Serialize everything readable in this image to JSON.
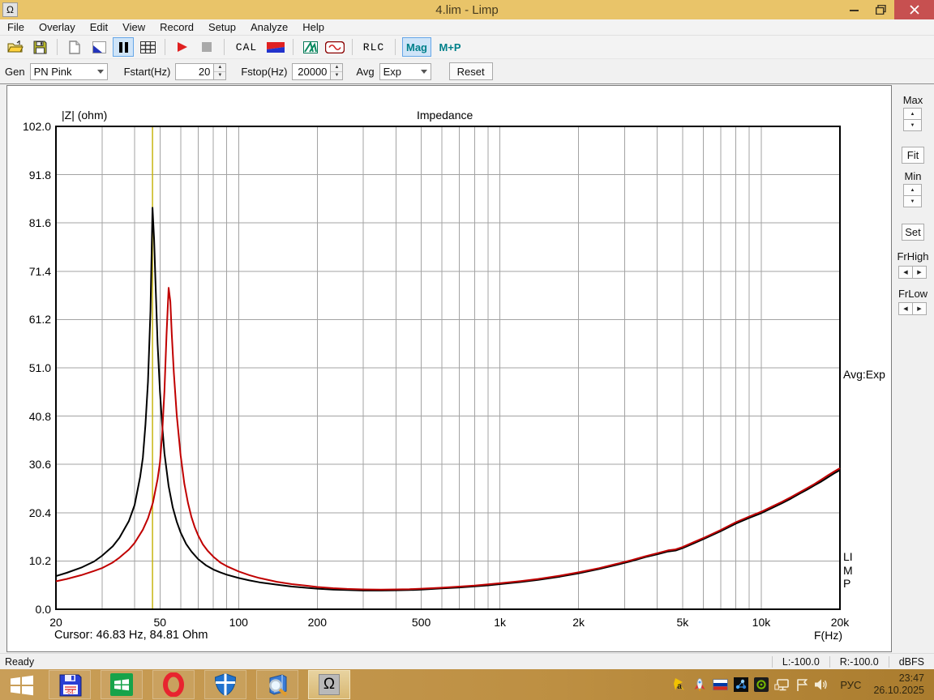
{
  "window": {
    "title": "4.lim - Limp",
    "icon_glyph": "Ω"
  },
  "menu": {
    "items": [
      "File",
      "Overlay",
      "Edit",
      "View",
      "Record",
      "Setup",
      "Analyze",
      "Help"
    ]
  },
  "toolbar": {
    "cal_label": "CAL",
    "rlc_label": "RLC",
    "mag_label": "Mag",
    "mp_label": "M+P",
    "icons": [
      "open-file-icon",
      "save-icon",
      "copy-icon",
      "generator-setup-icon",
      "pause-icon",
      "table-icon",
      "record-play-icon",
      "stop-icon",
      "calibrate-icon",
      "level-meter-icon",
      "spectrum-icon",
      "sine-wave-icon",
      "rlc-meter-icon",
      "magnitude-view-icon",
      "magnitude-phase-view-icon"
    ]
  },
  "controls": {
    "gen_label": "Gen",
    "gen_value": "PN Pink",
    "fstart_label": "Fstart(Hz)",
    "fstart_value": "20",
    "fstop_label": "Fstop(Hz)",
    "fstop_value": "20000",
    "avg_label": "Avg",
    "avg_value": "Exp",
    "reset_label": "Reset"
  },
  "right_panel": {
    "max_label": "Max",
    "fit_label": "Fit",
    "min_label": "Min",
    "set_label": "Set",
    "frhigh_label": "FrHigh",
    "frlow_label": "FrLow"
  },
  "chart_annotations": {
    "avg_text": "Avg:Exp",
    "limp_vertical": "LIMP",
    "cursor_text": "Cursor: 46.83 Hz, 84.81 Ohm",
    "x_unit": "F(Hz)"
  },
  "chart_data": {
    "type": "line",
    "title": "Impedance",
    "ylabel": "|Z| (ohm)",
    "xlabel": "F(Hz)",
    "x_scale": "log",
    "xlim": [
      20,
      20000
    ],
    "ylim": [
      0,
      102
    ],
    "y_ticks": [
      0,
      10.2,
      20.4,
      30.6,
      40.8,
      51.0,
      61.2,
      71.4,
      81.6,
      91.8,
      102.0
    ],
    "y_tick_labels": [
      "0.0",
      "10.2",
      "20.4",
      "30.6",
      "40.8",
      "51.0",
      "61.2",
      "71.4",
      "81.6",
      "91.8",
      "102.0"
    ],
    "x_ticks": [
      20,
      50,
      100,
      200,
      500,
      1000,
      2000,
      5000,
      10000,
      20000
    ],
    "x_tick_labels": [
      "20",
      "50",
      "100",
      "200",
      "500",
      "1k",
      "2k",
      "5k",
      "10k",
      "20k"
    ],
    "x_gridlines": [
      30,
      40,
      50,
      60,
      70,
      80,
      90,
      100,
      200,
      300,
      400,
      500,
      600,
      700,
      800,
      900,
      1000,
      2000,
      3000,
      4000,
      5000,
      6000,
      7000,
      8000,
      9000,
      10000
    ],
    "grid": true,
    "legend": "none",
    "cursor": {
      "freq": 46.83,
      "ohm": 84.81,
      "color": "#c3b100"
    },
    "series": [
      {
        "name": "impedance-current",
        "color": "#000000",
        "points": [
          [
            20,
            7.0
          ],
          [
            22,
            7.7
          ],
          [
            25,
            8.8
          ],
          [
            28,
            10.1
          ],
          [
            30,
            11.3
          ],
          [
            33,
            13.3
          ],
          [
            35,
            15.1
          ],
          [
            38,
            18.6
          ],
          [
            40,
            22
          ],
          [
            42,
            28
          ],
          [
            43,
            32
          ],
          [
            44,
            39
          ],
          [
            45,
            48
          ],
          [
            46,
            63
          ],
          [
            46.83,
            84.81
          ],
          [
            47.5,
            78
          ],
          [
            48,
            70
          ],
          [
            49,
            56
          ],
          [
            50,
            46
          ],
          [
            51,
            39
          ],
          [
            52,
            33
          ],
          [
            54,
            26
          ],
          [
            56,
            21.5
          ],
          [
            58,
            18.5
          ],
          [
            60,
            16.2
          ],
          [
            63,
            13.8
          ],
          [
            66,
            12.2
          ],
          [
            70,
            10.6
          ],
          [
            75,
            9.3
          ],
          [
            80,
            8.4
          ],
          [
            85,
            7.8
          ],
          [
            90,
            7.3
          ],
          [
            100,
            6.6
          ],
          [
            110,
            6.1
          ],
          [
            120,
            5.7
          ],
          [
            140,
            5.2
          ],
          [
            160,
            4.8
          ],
          [
            180,
            4.55
          ],
          [
            200,
            4.35
          ],
          [
            230,
            4.15
          ],
          [
            260,
            4.05
          ],
          [
            300,
            3.95
          ],
          [
            350,
            3.95
          ],
          [
            400,
            4.0
          ],
          [
            450,
            4.05
          ],
          [
            500,
            4.15
          ],
          [
            600,
            4.4
          ],
          [
            700,
            4.6
          ],
          [
            800,
            4.85
          ],
          [
            900,
            5.05
          ],
          [
            1000,
            5.3
          ],
          [
            1200,
            5.75
          ],
          [
            1400,
            6.2
          ],
          [
            1700,
            6.9
          ],
          [
            2000,
            7.6
          ],
          [
            2400,
            8.5
          ],
          [
            2800,
            9.4
          ],
          [
            3200,
            10.2
          ],
          [
            3600,
            11.0
          ],
          [
            4000,
            11.6
          ],
          [
            4400,
            12.2
          ],
          [
            4700,
            12.4
          ],
          [
            5000,
            12.9
          ],
          [
            5500,
            13.9
          ],
          [
            6000,
            14.8
          ],
          [
            7000,
            16.5
          ],
          [
            8000,
            18.1
          ],
          [
            9000,
            19.3
          ],
          [
            10000,
            20.3
          ],
          [
            11000,
            21.4
          ],
          [
            12000,
            22.4
          ],
          [
            13000,
            23.4
          ],
          [
            14000,
            24.4
          ],
          [
            15000,
            25.3
          ],
          [
            16000,
            26.2
          ],
          [
            17000,
            27.0
          ],
          [
            18000,
            27.9
          ],
          [
            19000,
            28.7
          ],
          [
            20000,
            29.4
          ]
        ]
      },
      {
        "name": "impedance-overlay",
        "color": "#c00000",
        "points": [
          [
            20,
            5.9
          ],
          [
            22,
            6.4
          ],
          [
            25,
            7.2
          ],
          [
            28,
            8.1
          ],
          [
            30,
            8.7
          ],
          [
            33,
            9.9
          ],
          [
            35,
            10.9
          ],
          [
            38,
            12.6
          ],
          [
            40,
            14.0
          ],
          [
            43,
            16.8
          ],
          [
            45,
            19.2
          ],
          [
            47,
            22.5
          ],
          [
            49,
            27.5
          ],
          [
            50,
            31
          ],
          [
            51,
            37
          ],
          [
            52,
            46
          ],
          [
            53,
            58
          ],
          [
            54,
            67.9
          ],
          [
            54.8,
            65
          ],
          [
            55.5,
            58
          ],
          [
            56.5,
            50
          ],
          [
            58,
            41
          ],
          [
            60,
            32.5
          ],
          [
            62,
            26.5
          ],
          [
            64,
            22.5
          ],
          [
            66,
            19.5
          ],
          [
            68,
            17.3
          ],
          [
            70,
            15.6
          ],
          [
            73,
            13.7
          ],
          [
            76,
            12.4
          ],
          [
            80,
            11.1
          ],
          [
            85,
            9.9
          ],
          [
            90,
            9.1
          ],
          [
            100,
            8.0
          ],
          [
            110,
            7.2
          ],
          [
            120,
            6.6
          ],
          [
            140,
            5.8
          ],
          [
            160,
            5.3
          ],
          [
            180,
            5.0
          ],
          [
            200,
            4.7
          ],
          [
            230,
            4.45
          ],
          [
            260,
            4.3
          ],
          [
            300,
            4.2
          ],
          [
            350,
            4.15
          ],
          [
            400,
            4.2
          ],
          [
            450,
            4.25
          ],
          [
            500,
            4.35
          ],
          [
            600,
            4.55
          ],
          [
            700,
            4.8
          ],
          [
            800,
            5.0
          ],
          [
            900,
            5.25
          ],
          [
            1000,
            5.5
          ],
          [
            1200,
            5.95
          ],
          [
            1400,
            6.4
          ],
          [
            1700,
            7.1
          ],
          [
            2000,
            7.8
          ],
          [
            2400,
            8.7
          ],
          [
            2800,
            9.6
          ],
          [
            3200,
            10.4
          ],
          [
            3600,
            11.2
          ],
          [
            4000,
            11.85
          ],
          [
            4400,
            12.45
          ],
          [
            4700,
            12.65
          ],
          [
            5000,
            13.15
          ],
          [
            5500,
            14.15
          ],
          [
            6000,
            15.05
          ],
          [
            7000,
            16.75
          ],
          [
            8000,
            18.4
          ],
          [
            9000,
            19.6
          ],
          [
            10000,
            20.6
          ],
          [
            11000,
            21.7
          ],
          [
            12000,
            22.7
          ],
          [
            13000,
            23.7
          ],
          [
            14000,
            24.7
          ],
          [
            15000,
            25.6
          ],
          [
            16000,
            26.5
          ],
          [
            17000,
            27.4
          ],
          [
            18000,
            28.3
          ],
          [
            19000,
            29.1
          ],
          [
            20000,
            29.8
          ]
        ]
      }
    ]
  },
  "status_bar": {
    "ready": "Ready",
    "left_db": "L:-100.0",
    "right_db": "R:-100.0",
    "unit": "dBFS"
  },
  "taskbar": {
    "lang": "РУС",
    "time": "23:47",
    "date": "26.10.2025",
    "app_icons": [
      "start-icon",
      "floppy64-app-icon",
      "store-app-icon",
      "opera-app-icon",
      "defender-app-icon",
      "search-app-icon",
      "limp-omega-app-icon"
    ],
    "tray_icons": [
      "punto-switcher-icon",
      "rocket-icon",
      "ru-flag-icon",
      "molecule-icon",
      "nvidia-icon",
      "network-icon",
      "action-center-flag-icon",
      "speaker-icon"
    ]
  },
  "colors": {
    "titlebar": "#e9c469",
    "taskbar_left": "#c99e58",
    "taskbar_right": "#aa7c2e",
    "close_button": "#c75050",
    "selected_tool_bg": "#cfe4f8",
    "selected_tool_border": "#66a7e8",
    "grid": "#a3a3a3",
    "plot_border": "#000000",
    "curve1": "#000000",
    "curve2": "#c00000",
    "cursor_line": "#c3b100",
    "teal_text": "#00808a"
  }
}
